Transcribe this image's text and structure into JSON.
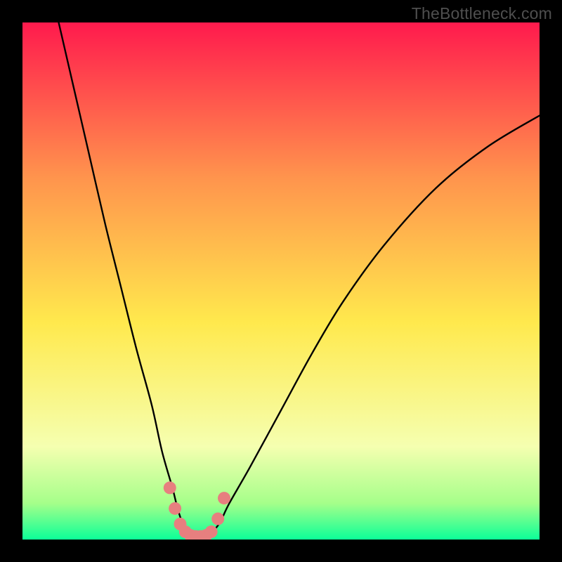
{
  "watermark": "TheBottleneck.com",
  "colors": {
    "gradient_top": "#ff1a4d",
    "gradient_mid_upper": "#ff944d",
    "gradient_mid": "#ffe94d",
    "gradient_lower": "#f5ffb0",
    "gradient_near_bottom": "#a5ff8a",
    "gradient_bottom": "#0cff98",
    "curve": "#000000",
    "marker": "#e77f7f",
    "frame": "#000000"
  },
  "chart_data": {
    "type": "line",
    "title": "",
    "xlabel": "",
    "ylabel": "",
    "xlim": [
      0,
      100
    ],
    "ylim": [
      0,
      100
    ],
    "grid": false,
    "legend": false,
    "notes": "V-shaped bottleneck curve. x interpreted as 0–100% horizontal position; y as 0 (bottom, green = no bottleneck) to 100 (top, red = max bottleneck). Minimum (optimal point) near x ≈ 32, y ≈ 0.",
    "series": [
      {
        "name": "bottleneck-curve",
        "x": [
          7,
          10,
          13,
          16,
          19,
          22,
          25,
          27,
          29,
          30,
          31,
          32,
          34,
          36,
          38,
          40,
          44,
          50,
          56,
          62,
          70,
          80,
          90,
          100
        ],
        "y": [
          100,
          87,
          74,
          61,
          49,
          37,
          26,
          17,
          10,
          6,
          3,
          1,
          0.5,
          1,
          3,
          7,
          14,
          25,
          36,
          46,
          57,
          68,
          76,
          82
        ]
      }
    ],
    "markers": {
      "name": "highlight-dots",
      "note": "Salmon dots near trough emphasizing the optimal balance range.",
      "points": [
        {
          "x": 28.5,
          "y": 10
        },
        {
          "x": 29.5,
          "y": 6
        },
        {
          "x": 30.5,
          "y": 3
        },
        {
          "x": 31.5,
          "y": 1.5
        },
        {
          "x": 32.5,
          "y": 0.8
        },
        {
          "x": 33.5,
          "y": 0.6
        },
        {
          "x": 34.5,
          "y": 0.6
        },
        {
          "x": 35.5,
          "y": 0.8
        },
        {
          "x": 36.5,
          "y": 1.5
        },
        {
          "x": 37.8,
          "y": 4
        },
        {
          "x": 39.0,
          "y": 8
        }
      ]
    }
  }
}
